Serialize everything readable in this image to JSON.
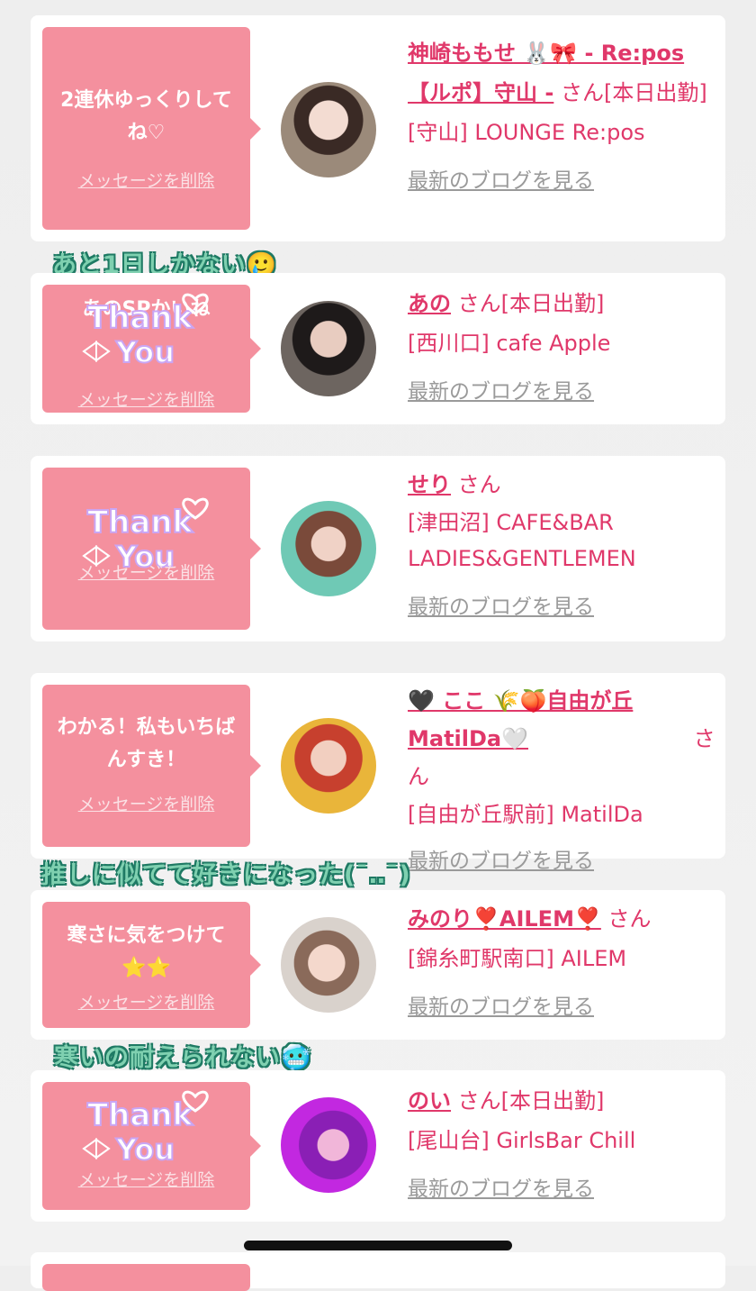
{
  "cards": [
    {
      "message": "2連休ゆっくりしてね♡",
      "delete_label": "メッセージを削除",
      "name": "神崎ももせ 🐰🎀 - Re:pos 【ルポ】守山 -",
      "san_label": "さん[本日出勤]",
      "shop": "[守山] LOUNGE Re:pos",
      "blog_link": "最新のブログを見る"
    },
    {
      "message": "あのSPかいね",
      "delete_label": "メッセージを削除",
      "name": "あの",
      "san_label": "さん[本日出勤]",
      "shop": "[西川口] cafe Apple",
      "blog_link": "最新のブログを見る"
    },
    {
      "message": "",
      "delete_label": "メッセージを削除",
      "name": "せり",
      "san_label": "さん",
      "shop": "[津田沼] CAFE&BAR LADIES&GENTLEMEN",
      "blog_link": "最新のブログを見る"
    },
    {
      "message": "わかる！私もいちばんすき！",
      "delete_label": "メッセージを削除",
      "name": "🖤 ここ 🌾🍑自由が丘MatilDa🤍",
      "san_label": "さん",
      "shop": "[自由が丘駅前] MatilDa",
      "blog_link": "最新のブログを見る"
    },
    {
      "message": "寒さに気をつけて⭐️⭐️",
      "delete_label": "メッセージを削除",
      "name": "みのり❣️AILEM❣️",
      "san_label": "さん",
      "shop": "[錦糸町駅南口] AILEM",
      "blog_link": "最新のブログを見る"
    },
    {
      "message": "",
      "delete_label": "メッセージを削除",
      "name": "のい",
      "san_label": "さん[本日出勤]",
      "shop": "[尾山台] GirlsBar Chill",
      "blog_link": "最新のブログを見る"
    }
  ],
  "stickers": {
    "s1": "あと1日しかない🥲",
    "s2": "推しに似てて好きになった(¯‥¯)",
    "s3": "寒いの耐えられない🥶"
  },
  "thank_you_sticker": {
    "line1": "Thank",
    "line2": "You"
  }
}
